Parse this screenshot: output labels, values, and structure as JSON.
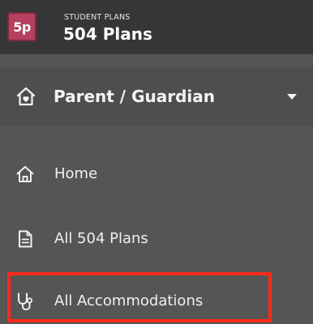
{
  "header": {
    "logo_text": "5p",
    "subtitle": "STUDENT PLANS",
    "title": "504 Plans",
    "brand_color": "#b5405f"
  },
  "role_selector": {
    "label": "Parent / Guardian",
    "icon": "home-heart-icon",
    "caret_icon": "caret-down-icon"
  },
  "nav": {
    "items": [
      {
        "label": "Home",
        "icon": "home-icon"
      },
      {
        "label": "All 504 Plans",
        "icon": "document-icon"
      },
      {
        "label": "All Accommodations",
        "icon": "stethoscope-icon",
        "highlighted": true
      }
    ]
  },
  "colors": {
    "header_bg": "#363636",
    "sidebar_bg": "#555555",
    "role_bg": "#4e4e4e",
    "highlight": "#ff2a1a"
  }
}
